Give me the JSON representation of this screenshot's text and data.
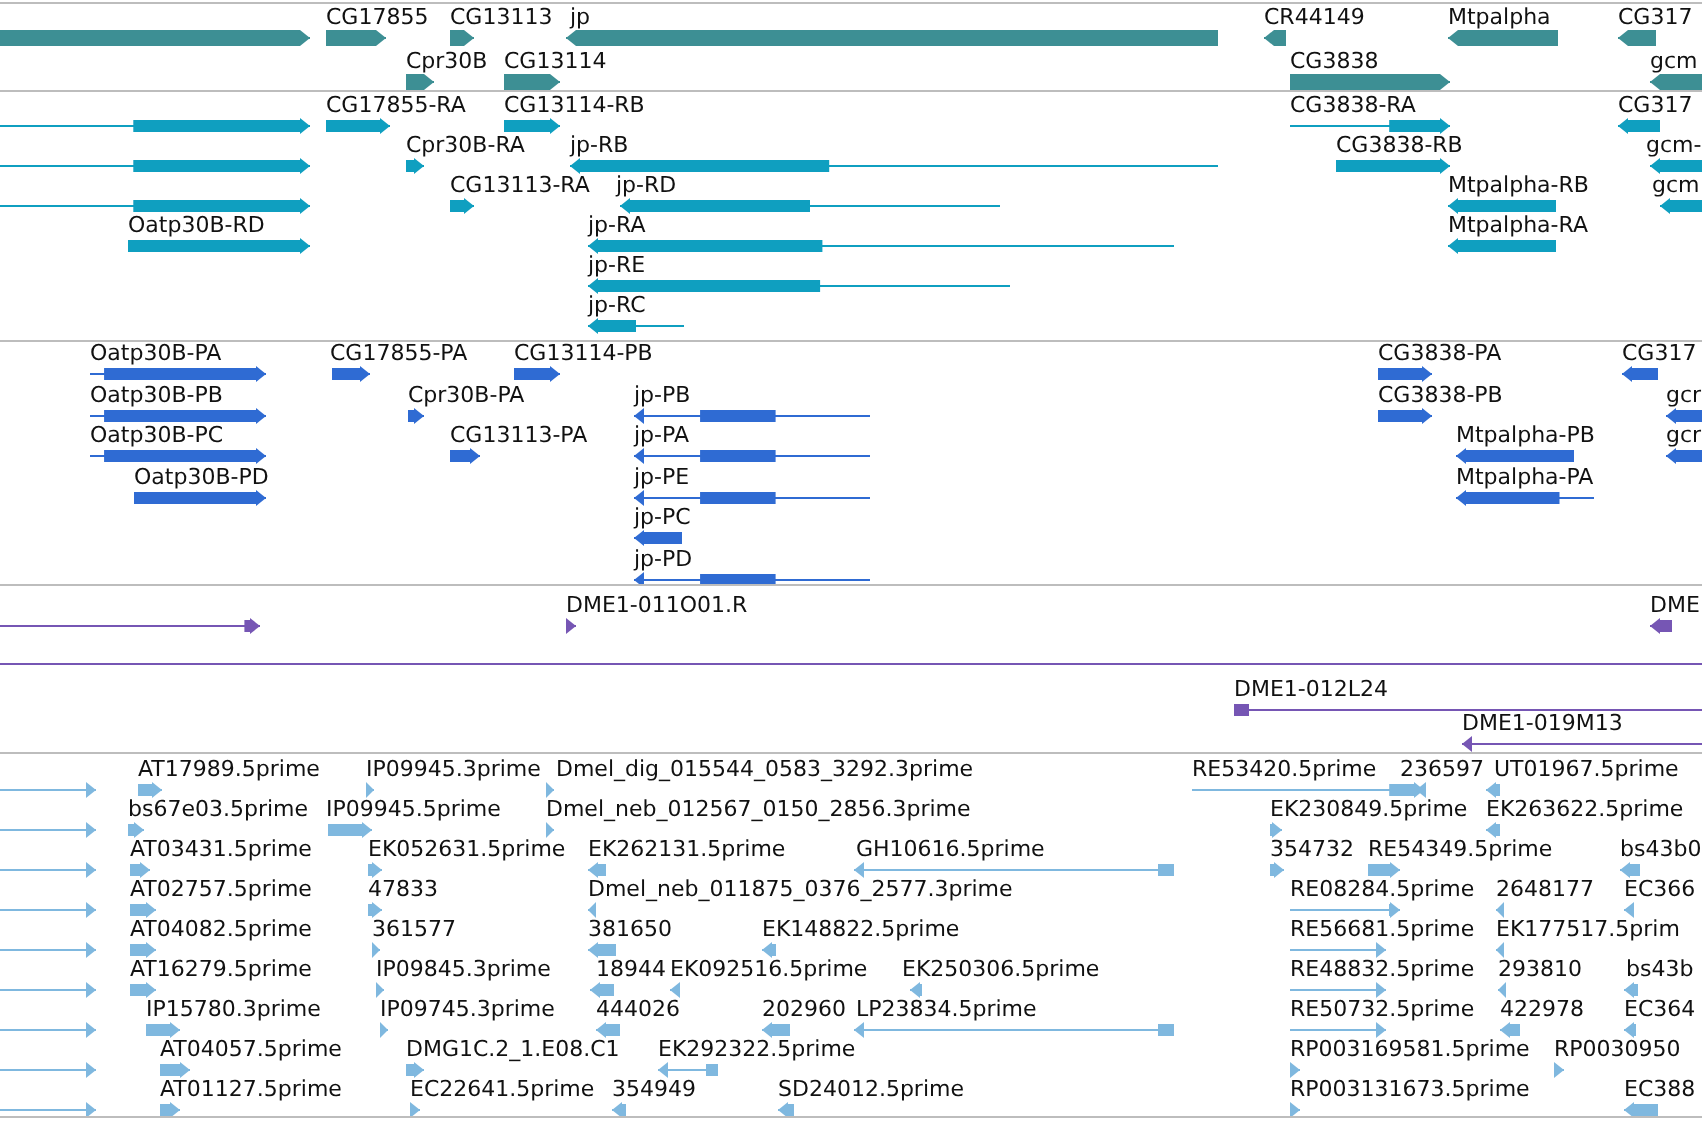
{
  "tracks": [
    {
      "kind": "gene",
      "color": "#3d8f94",
      "features": [
        {
          "reverse": false
        },
        {
          "label": "CG17855",
          "reverse": false
        },
        {
          "label": "CG13113",
          "reverse": false
        },
        {
          "label": "jp",
          "reverse": true
        },
        {
          "label": "CR44149",
          "reverse": true
        },
        {
          "label": "Mtpalpha",
          "reverse": true
        },
        {
          "label": "CG317",
          "reverse": true
        },
        {
          "label": "Cpr30B",
          "reverse": false
        },
        {
          "label": "CG13114",
          "reverse": false
        },
        {
          "label": "CG3838",
          "reverse": false
        },
        {
          "label": "gcm",
          "reverse": true
        }
      ]
    },
    {
      "kind": "transcript",
      "color": "#0f9fc0",
      "features": [
        {
          "reverse": false
        },
        {
          "label": "CG17855-RA",
          "reverse": false
        },
        {
          "label": "CG13114-RB",
          "reverse": false
        },
        {
          "label": "CG3838-RA",
          "reverse": false
        },
        {
          "label": "CG317",
          "reverse": true
        },
        {
          "reverse": false
        },
        {
          "label": "Cpr30B-RA",
          "reverse": false
        },
        {
          "label": "jp-RB",
          "reverse": true
        },
        {
          "label": "CG3838-RB",
          "reverse": false
        },
        {
          "label": "gcm-",
          "reverse": true
        },
        {
          "reverse": false
        },
        {
          "label": "CG13113-RA",
          "reverse": false
        },
        {
          "label": "jp-RD",
          "reverse": true
        },
        {
          "label": "Mtpalpha-RB",
          "reverse": true
        },
        {
          "label": "gcm",
          "reverse": true
        },
        {
          "label": "Oatp30B-RD",
          "reverse": false
        },
        {
          "label": "jp-RA",
          "reverse": true
        },
        {
          "label": "Mtpalpha-RA",
          "reverse": true
        },
        {
          "label": "jp-RE",
          "reverse": true
        },
        {
          "label": "jp-RC",
          "reverse": true
        }
      ]
    },
    {
      "kind": "protein",
      "color": "#2f6bd3",
      "features": [
        {
          "label": "Oatp30B-PA",
          "reverse": false
        },
        {
          "label": "CG17855-PA",
          "reverse": false
        },
        {
          "label": "CG13114-PB",
          "reverse": false
        },
        {
          "label": "CG3838-PA",
          "reverse": false
        },
        {
          "label": "CG317",
          "reverse": true
        },
        {
          "label": "Oatp30B-PB",
          "reverse": false
        },
        {
          "label": "Cpr30B-PA",
          "reverse": false
        },
        {
          "label": "jp-PB",
          "reverse": true
        },
        {
          "label": "CG3838-PB",
          "reverse": false
        },
        {
          "label": "gcr",
          "reverse": true
        },
        {
          "label": "Oatp30B-PC",
          "reverse": false
        },
        {
          "label": "CG13113-PA",
          "reverse": false
        },
        {
          "label": "jp-PA",
          "reverse": true
        },
        {
          "label": "Mtpalpha-PB",
          "reverse": true
        },
        {
          "label": "gcr",
          "reverse": true
        },
        {
          "label": "Oatp30B-PD",
          "reverse": false
        },
        {
          "label": "jp-PE",
          "reverse": true
        },
        {
          "label": "Mtpalpha-PA",
          "reverse": true
        },
        {
          "label": "jp-PC",
          "reverse": true
        },
        {
          "label": "jp-PD",
          "reverse": true
        }
      ]
    },
    {
      "kind": "clone",
      "color": "#7656b4",
      "features": [
        {
          "reverse": false
        },
        {
          "label": "DME1-011O01.R",
          "reverse": false
        },
        {
          "label": "DME",
          "reverse": true
        },
        {
          "reverse": false
        },
        {
          "label": "DME1-012L24",
          "reverse": false
        },
        {
          "label": "DME1-019M13",
          "reverse": true
        }
      ]
    },
    {
      "kind": "est",
      "color": "#7fb8df",
      "features": [
        {
          "reverse": false
        },
        {
          "label": "AT17989.5prime",
          "reverse": false
        },
        {
          "label": "IP09945.3prime",
          "reverse": false
        },
        {
          "label": "Dmel_dig_015544_0583_3292.3prime",
          "reverse": false
        },
        {
          "label": "RE53420.5prime",
          "reverse": false
        },
        {
          "label": "236597",
          "reverse": true
        },
        {
          "label": "UT01967.5prime",
          "reverse": true
        },
        {
          "reverse": false
        },
        {
          "label": "bs67e03.5prime",
          "reverse": false
        },
        {
          "label": "IP09945.5prime",
          "reverse": false
        },
        {
          "label": "Dmel_neb_012567_0150_2856.3prime",
          "reverse": false
        },
        {
          "label": "EK230849.5prime",
          "reverse": false
        },
        {
          "label": "EK263622.5prime",
          "reverse": true
        },
        {
          "reverse": false
        },
        {
          "label": "AT03431.5prime",
          "reverse": false
        },
        {
          "label": "EK052631.5prime",
          "reverse": false
        },
        {
          "label": "EK262131.5prime",
          "reverse": true
        },
        {
          "label": "GH10616.5prime",
          "reverse": true
        },
        {
          "label": "354732",
          "reverse": false
        },
        {
          "label": "RE54349.5prime",
          "reverse": false
        },
        {
          "label": "bs43b0",
          "reverse": true
        },
        {
          "reverse": false
        },
        {
          "label": "AT02757.5prime",
          "reverse": false
        },
        {
          "label": "47833",
          "reverse": false
        },
        {
          "label": "Dmel_neb_011875_0376_2577.3prime",
          "reverse": true
        },
        {
          "label": "RE08284.5prime",
          "reverse": false
        },
        {
          "label": "2648177",
          "reverse": true
        },
        {
          "label": "EC366",
          "reverse": true
        },
        {
          "reverse": false
        },
        {
          "label": "AT04082.5prime",
          "reverse": false
        },
        {
          "label": "361577",
          "reverse": false
        },
        {
          "label": "381650",
          "reverse": true
        },
        {
          "label": "EK148822.5prime",
          "reverse": true
        },
        {
          "label": "RE56681.5prime",
          "reverse": false
        },
        {
          "label": "EK177517.5prim",
          "reverse": true
        },
        {
          "reverse": false
        },
        {
          "label": "AT16279.5prime",
          "reverse": false
        },
        {
          "label": "IP09845.3prime",
          "reverse": false
        },
        {
          "label": "18944",
          "reverse": true
        },
        {
          "label": "EK092516.5prime",
          "reverse": true
        },
        {
          "label": "EK250306.5prime",
          "reverse": true
        },
        {
          "label": "RE48832.5prime",
          "reverse": false
        },
        {
          "label": "293810",
          "reverse": true
        },
        {
          "label": "bs43b",
          "reverse": true
        },
        {
          "reverse": false
        },
        {
          "label": "IP15780.3prime",
          "reverse": false
        },
        {
          "label": "IP09745.3prime",
          "reverse": false
        },
        {
          "label": "444026",
          "reverse": true
        },
        {
          "label": "202960",
          "reverse": true
        },
        {
          "label": "LP23834.5prime",
          "reverse": true
        },
        {
          "label": "RE50732.5prime",
          "reverse": false
        },
        {
          "label": "422978",
          "reverse": true
        },
        {
          "label": "EC364",
          "reverse": true
        },
        {
          "reverse": false
        },
        {
          "label": "AT04057.5prime",
          "reverse": false
        },
        {
          "label": "DMG1C.2_1.E08.C1",
          "reverse": false
        },
        {
          "label": "EK292322.5prime",
          "reverse": true
        },
        {
          "label": "RP003169581.5prime",
          "reverse": false
        },
        {
          "label": "RP0030950",
          "reverse": false
        },
        {
          "reverse": false
        },
        {
          "label": "AT01127.5prime",
          "reverse": false
        },
        {
          "label": "EC22641.5prime",
          "reverse": false
        },
        {
          "label": "354949",
          "reverse": true
        },
        {
          "label": "SD24012.5prime",
          "reverse": true
        },
        {
          "label": "RP003131673.5prime",
          "reverse": false
        },
        {
          "label": "EC388",
          "reverse": true
        }
      ]
    }
  ]
}
